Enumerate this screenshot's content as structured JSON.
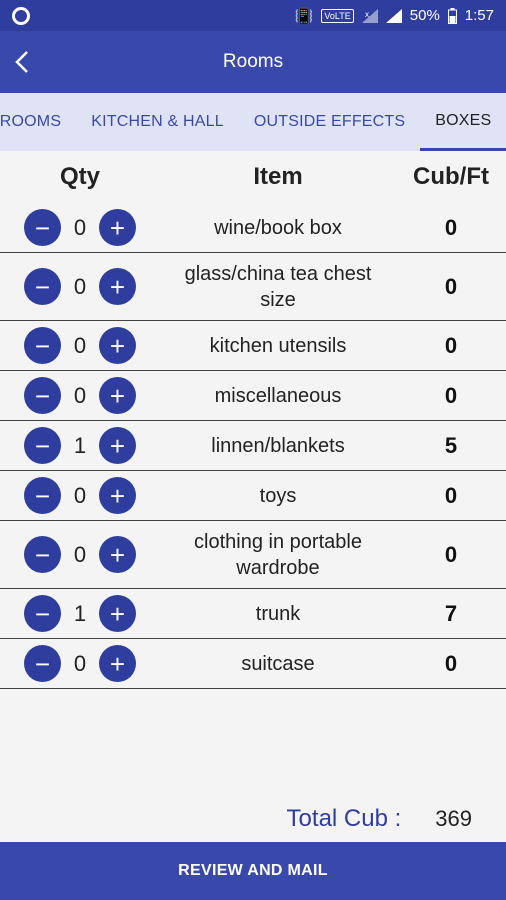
{
  "status_bar": {
    "battery": "50%",
    "time": "1:57",
    "volte": "VoLTE"
  },
  "app_bar": {
    "title": "Rooms"
  },
  "tabs": [
    {
      "label": "BEDROOMS",
      "display": "DROOMS"
    },
    {
      "label": "KITCHEN & HALL"
    },
    {
      "label": "OUTSIDE EFFECTS"
    },
    {
      "label": "BOXES"
    }
  ],
  "table": {
    "headers": {
      "qty": "Qty",
      "item": "Item",
      "cub": "Cub/Ft"
    },
    "minus": "−",
    "plus": "+",
    "rows": [
      {
        "qty": "0",
        "item": "wine/book box",
        "cub": "0"
      },
      {
        "qty": "0",
        "item": "glass/china tea chest size",
        "cub": "0"
      },
      {
        "qty": "0",
        "item": "kitchen utensils",
        "cub": "0"
      },
      {
        "qty": "0",
        "item": "miscellaneous",
        "cub": "0"
      },
      {
        "qty": "1",
        "item": "linnen/blankets",
        "cub": "5"
      },
      {
        "qty": "0",
        "item": "toys",
        "cub": "0"
      },
      {
        "qty": "0",
        "item": "clothing in portable wardrobe",
        "cub": "0"
      },
      {
        "qty": "1",
        "item": "trunk",
        "cub": "7"
      },
      {
        "qty": "0",
        "item": "suitcase",
        "cub": "0"
      }
    ]
  },
  "total": {
    "label": "Total Cub :",
    "value": "369"
  },
  "footer": {
    "button": "REVIEW AND MAIL"
  }
}
